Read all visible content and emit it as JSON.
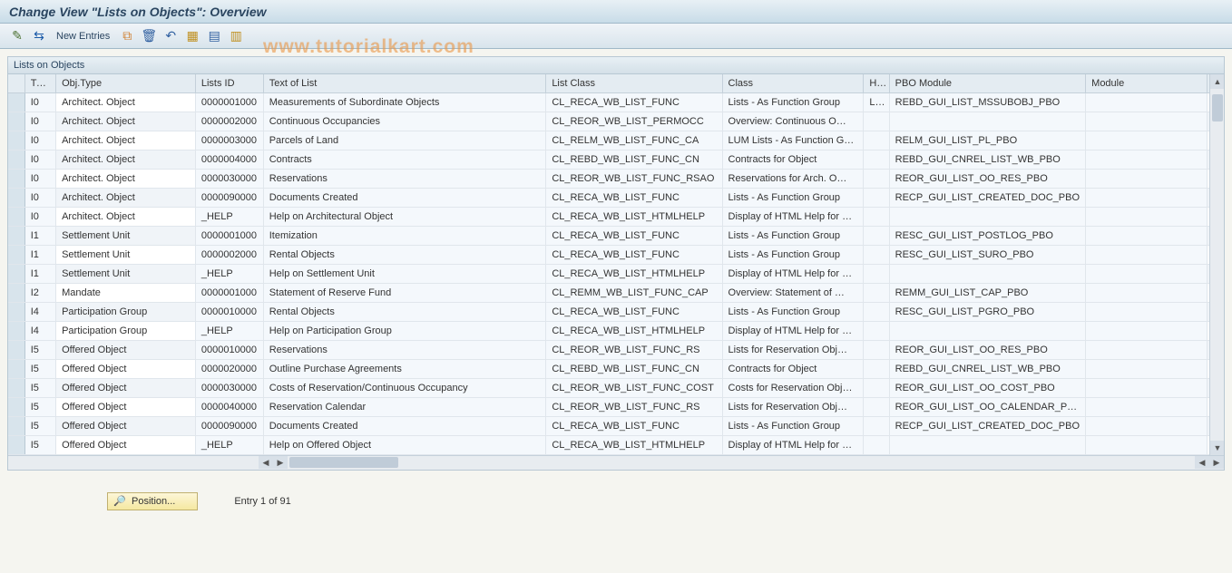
{
  "title": "Change View \"Lists on Objects\": Overview",
  "watermark": "www.tutorialkart.com",
  "toolbar": {
    "new_entries_label": "New Entries"
  },
  "panel": {
    "title": "Lists on Objects"
  },
  "columns": {
    "type": "Type",
    "objtype": "Obj.Type",
    "listsid": "Lists ID",
    "text": "Text of List",
    "listclass": "List Class",
    "class": "Class",
    "ha": "Ha..",
    "pbo": "PBO Module",
    "module": "Module"
  },
  "rows": [
    {
      "type": "I0",
      "objtype": "Architect. Object",
      "listsid": "0000001000",
      "text": "Measurements of Subordinate Objects",
      "listclass": "CL_RECA_WB_LIST_FUNC",
      "class": "Lists - As Function Group",
      "ha": "LIMS",
      "pbo": "REBD_GUI_LIST_MSSUBOBJ_PBO",
      "module": ""
    },
    {
      "type": "I0",
      "objtype": "Architect. Object",
      "listsid": "0000002000",
      "text": "Continuous Occupancies",
      "listclass": "CL_REOR_WB_LIST_PERMOCC",
      "class": "Overview: Continuous O…",
      "ha": "",
      "pbo": "",
      "module": ""
    },
    {
      "type": "I0",
      "objtype": "Architect. Object",
      "listsid": "0000003000",
      "text": "Parcels of Land",
      "listclass": "CL_RELM_WB_LIST_FUNC_CA",
      "class": "LUM Lists - As Function G…",
      "ha": "",
      "pbo": "RELM_GUI_LIST_PL_PBO",
      "module": ""
    },
    {
      "type": "I0",
      "objtype": "Architect. Object",
      "listsid": "0000004000",
      "text": "Contracts",
      "listclass": "CL_REBD_WB_LIST_FUNC_CN",
      "class": "Contracts for Object",
      "ha": "",
      "pbo": "REBD_GUI_CNREL_LIST_WB_PBO",
      "module": ""
    },
    {
      "type": "I0",
      "objtype": "Architect. Object",
      "listsid": "0000030000",
      "text": "Reservations",
      "listclass": "CL_REOR_WB_LIST_FUNC_RSAO",
      "class": "Reservations for Arch. O…",
      "ha": "",
      "pbo": "REOR_GUI_LIST_OO_RES_PBO",
      "module": ""
    },
    {
      "type": "I0",
      "objtype": "Architect. Object",
      "listsid": "0000090000",
      "text": "Documents Created",
      "listclass": "CL_RECA_WB_LIST_FUNC",
      "class": "Lists - As Function Group",
      "ha": "",
      "pbo": "RECP_GUI_LIST_CREATED_DOC_PBO",
      "module": ""
    },
    {
      "type": "I0",
      "objtype": "Architect. Object",
      "listsid": "_HELP",
      "text": "Help on Architectural Object",
      "listclass": "CL_RECA_WB_LIST_HTMLHELP",
      "class": "Display of HTML Help for …",
      "ha": "",
      "pbo": "",
      "module": ""
    },
    {
      "type": "I1",
      "objtype": "Settlement Unit",
      "listsid": "0000001000",
      "text": "Itemization",
      "listclass": "CL_RECA_WB_LIST_FUNC",
      "class": "Lists - As Function Group",
      "ha": "",
      "pbo": "RESC_GUI_LIST_POSTLOG_PBO",
      "module": ""
    },
    {
      "type": "I1",
      "objtype": "Settlement Unit",
      "listsid": "0000002000",
      "text": "Rental Objects",
      "listclass": "CL_RECA_WB_LIST_FUNC",
      "class": "Lists - As Function Group",
      "ha": "",
      "pbo": "RESC_GUI_LIST_SURO_PBO",
      "module": ""
    },
    {
      "type": "I1",
      "objtype": "Settlement Unit",
      "listsid": "_HELP",
      "text": "Help on Settlement Unit",
      "listclass": "CL_RECA_WB_LIST_HTMLHELP",
      "class": "Display of HTML Help for …",
      "ha": "",
      "pbo": "",
      "module": ""
    },
    {
      "type": "I2",
      "objtype": "Mandate",
      "listsid": "0000001000",
      "text": "Statement of Reserve Fund",
      "listclass": "CL_REMM_WB_LIST_FUNC_CAP",
      "class": "Overview: Statement of …",
      "ha": "",
      "pbo": "REMM_GUI_LIST_CAP_PBO",
      "module": ""
    },
    {
      "type": "I4",
      "objtype": "Participation Group",
      "listsid": "0000010000",
      "text": "Rental Objects",
      "listclass": "CL_RECA_WB_LIST_FUNC",
      "class": "Lists - As Function Group",
      "ha": "",
      "pbo": "RESC_GUI_LIST_PGRO_PBO",
      "module": ""
    },
    {
      "type": "I4",
      "objtype": "Participation Group",
      "listsid": "_HELP",
      "text": "Help on Participation Group",
      "listclass": "CL_RECA_WB_LIST_HTMLHELP",
      "class": "Display of HTML Help for …",
      "ha": "",
      "pbo": "",
      "module": ""
    },
    {
      "type": "I5",
      "objtype": "Offered Object",
      "listsid": "0000010000",
      "text": "Reservations",
      "listclass": "CL_REOR_WB_LIST_FUNC_RS",
      "class": "Lists for Reservation Obj…",
      "ha": "",
      "pbo": "REOR_GUI_LIST_OO_RES_PBO",
      "module": ""
    },
    {
      "type": "I5",
      "objtype": "Offered Object",
      "listsid": "0000020000",
      "text": "Outline Purchase Agreements",
      "listclass": "CL_REBD_WB_LIST_FUNC_CN",
      "class": "Contracts for Object",
      "ha": "",
      "pbo": "REBD_GUI_CNREL_LIST_WB_PBO",
      "module": ""
    },
    {
      "type": "I5",
      "objtype": "Offered Object",
      "listsid": "0000030000",
      "text": "Costs of Reservation/Continuous Occupancy",
      "listclass": "CL_REOR_WB_LIST_FUNC_COST",
      "class": "Costs for Reservation Obj…",
      "ha": "",
      "pbo": "REOR_GUI_LIST_OO_COST_PBO",
      "module": ""
    },
    {
      "type": "I5",
      "objtype": "Offered Object",
      "listsid": "0000040000",
      "text": "Reservation Calendar",
      "listclass": "CL_REOR_WB_LIST_FUNC_RS",
      "class": "Lists for Reservation Obj…",
      "ha": "",
      "pbo": "REOR_GUI_LIST_OO_CALENDAR_PBO",
      "module": ""
    },
    {
      "type": "I5",
      "objtype": "Offered Object",
      "listsid": "0000090000",
      "text": "Documents Created",
      "listclass": "CL_RECA_WB_LIST_FUNC",
      "class": "Lists - As Function Group",
      "ha": "",
      "pbo": "RECP_GUI_LIST_CREATED_DOC_PBO",
      "module": ""
    },
    {
      "type": "I5",
      "objtype": "Offered Object",
      "listsid": "_HELP",
      "text": "Help on Offered Object",
      "listclass": "CL_RECA_WB_LIST_HTMLHELP",
      "class": "Display of HTML Help for …",
      "ha": "",
      "pbo": "",
      "module": ""
    }
  ],
  "footer": {
    "position_label": "Position...",
    "entry_text": "Entry 1 of 91"
  }
}
